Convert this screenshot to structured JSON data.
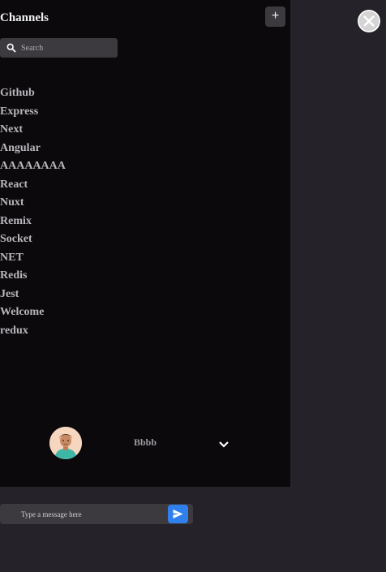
{
  "sidebar": {
    "title": "Channels",
    "add_label": "+",
    "search_placeholder": "Search",
    "channels": [
      "Github",
      "Express",
      "Next",
      "Angular",
      "AAAAAAAA",
      "React",
      "Nuxt",
      "Remix",
      "Socket",
      "NET",
      "Redis",
      "Jest",
      "Welcome",
      "redux"
    ]
  },
  "user": {
    "name": "Bbbb",
    "avatar_icon": "user-avatar"
  },
  "composer": {
    "placeholder": "Type a message here"
  },
  "colors": {
    "sidebar_bg": "#0b090c",
    "main_bg": "#252329",
    "accent": "#2f80ed"
  }
}
